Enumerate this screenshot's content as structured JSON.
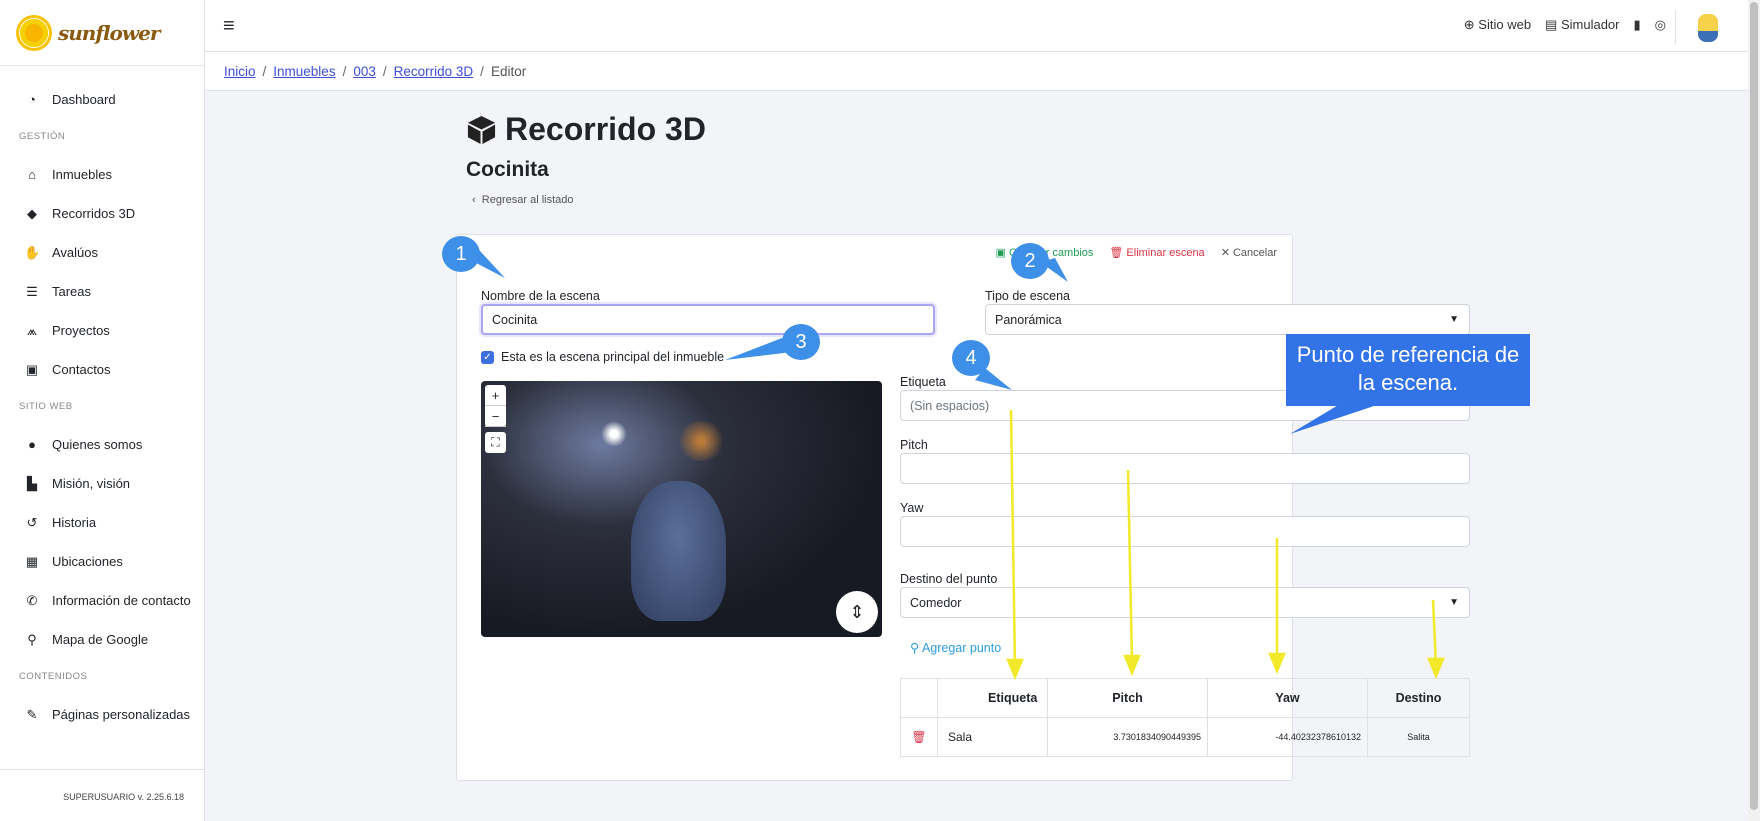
{
  "sidebar": {
    "logo_text": "sunflower",
    "items_main": [
      {
        "label": "Dashboard",
        "icon": "gauge-icon"
      }
    ],
    "sections": [
      {
        "title": "GESTIÓN",
        "items": [
          {
            "label": "Inmuebles",
            "icon": "home-icon"
          },
          {
            "label": "Recorridos 3D",
            "icon": "cube-icon"
          },
          {
            "label": "Avalúos",
            "icon": "hand-dollar-icon"
          },
          {
            "label": "Tareas",
            "icon": "list-check-icon"
          },
          {
            "label": "Proyectos",
            "icon": "compass-drafting-icon"
          },
          {
            "label": "Contactos",
            "icon": "address-book-icon"
          }
        ]
      },
      {
        "title": "SITIO WEB",
        "items": [
          {
            "label": "Quienes somos",
            "icon": "user-tie-icon"
          },
          {
            "label": "Misión, visión",
            "icon": "industry-icon"
          },
          {
            "label": "Historia",
            "icon": "history-icon"
          },
          {
            "label": "Ubicaciones",
            "icon": "map-location-icon"
          },
          {
            "label": "Información de contacto",
            "icon": "phone-icon"
          },
          {
            "label": "Mapa de Google",
            "icon": "map-pin-icon"
          }
        ]
      },
      {
        "title": "CONTENIDOS",
        "items": [
          {
            "label": "Páginas personalizadas",
            "icon": "file-pen-icon"
          }
        ]
      }
    ],
    "footer": "SUPERUSUARIO v. 2.25.6.18"
  },
  "topbar": {
    "sitio_web": "Sitio web",
    "simulador": "Simulador"
  },
  "breadcrumb": {
    "inicio": "Inicio",
    "inmuebles": "Inmuebles",
    "id": "003",
    "recorrido": "Recorrido 3D",
    "current": "Editor"
  },
  "page": {
    "title": "Recorrido 3D",
    "subtitle": "Cocinita",
    "back": "Regresar al listado"
  },
  "actions": {
    "save": "Guardar cambios",
    "delete": "Eliminar escena",
    "cancel": "Cancelar"
  },
  "form": {
    "name_label": "Nombre de la escena",
    "name_value": "Cocinita",
    "type_label": "Tipo de escena",
    "type_value": "Panorámica",
    "main_scene_label": "Esta es la escena principal del inmueble",
    "etiqueta_label": "Etiqueta",
    "etiqueta_placeholder": "(Sin espacios)",
    "pitch_label": "Pitch",
    "yaw_label": "Yaw",
    "destino_label": "Destino del punto",
    "destino_value": "Comedor",
    "add_point": "Agregar punto"
  },
  "table": {
    "headers": [
      "Etiqueta",
      "Pitch",
      "Yaw",
      "Destino"
    ],
    "rows": [
      {
        "etiqueta": "Sala",
        "pitch": "3.7301834090449395",
        "yaw": "-44.40232378610132",
        "destino": "Salita"
      }
    ]
  },
  "annotations": {
    "c1": "1",
    "c2": "2",
    "c3": "3",
    "c4": "4",
    "banner": "Punto de referencia de la escena."
  },
  "colors": {
    "accent": "#3d6fe0",
    "callout": "#3d8fe8",
    "arrow": "#f2e92a"
  }
}
